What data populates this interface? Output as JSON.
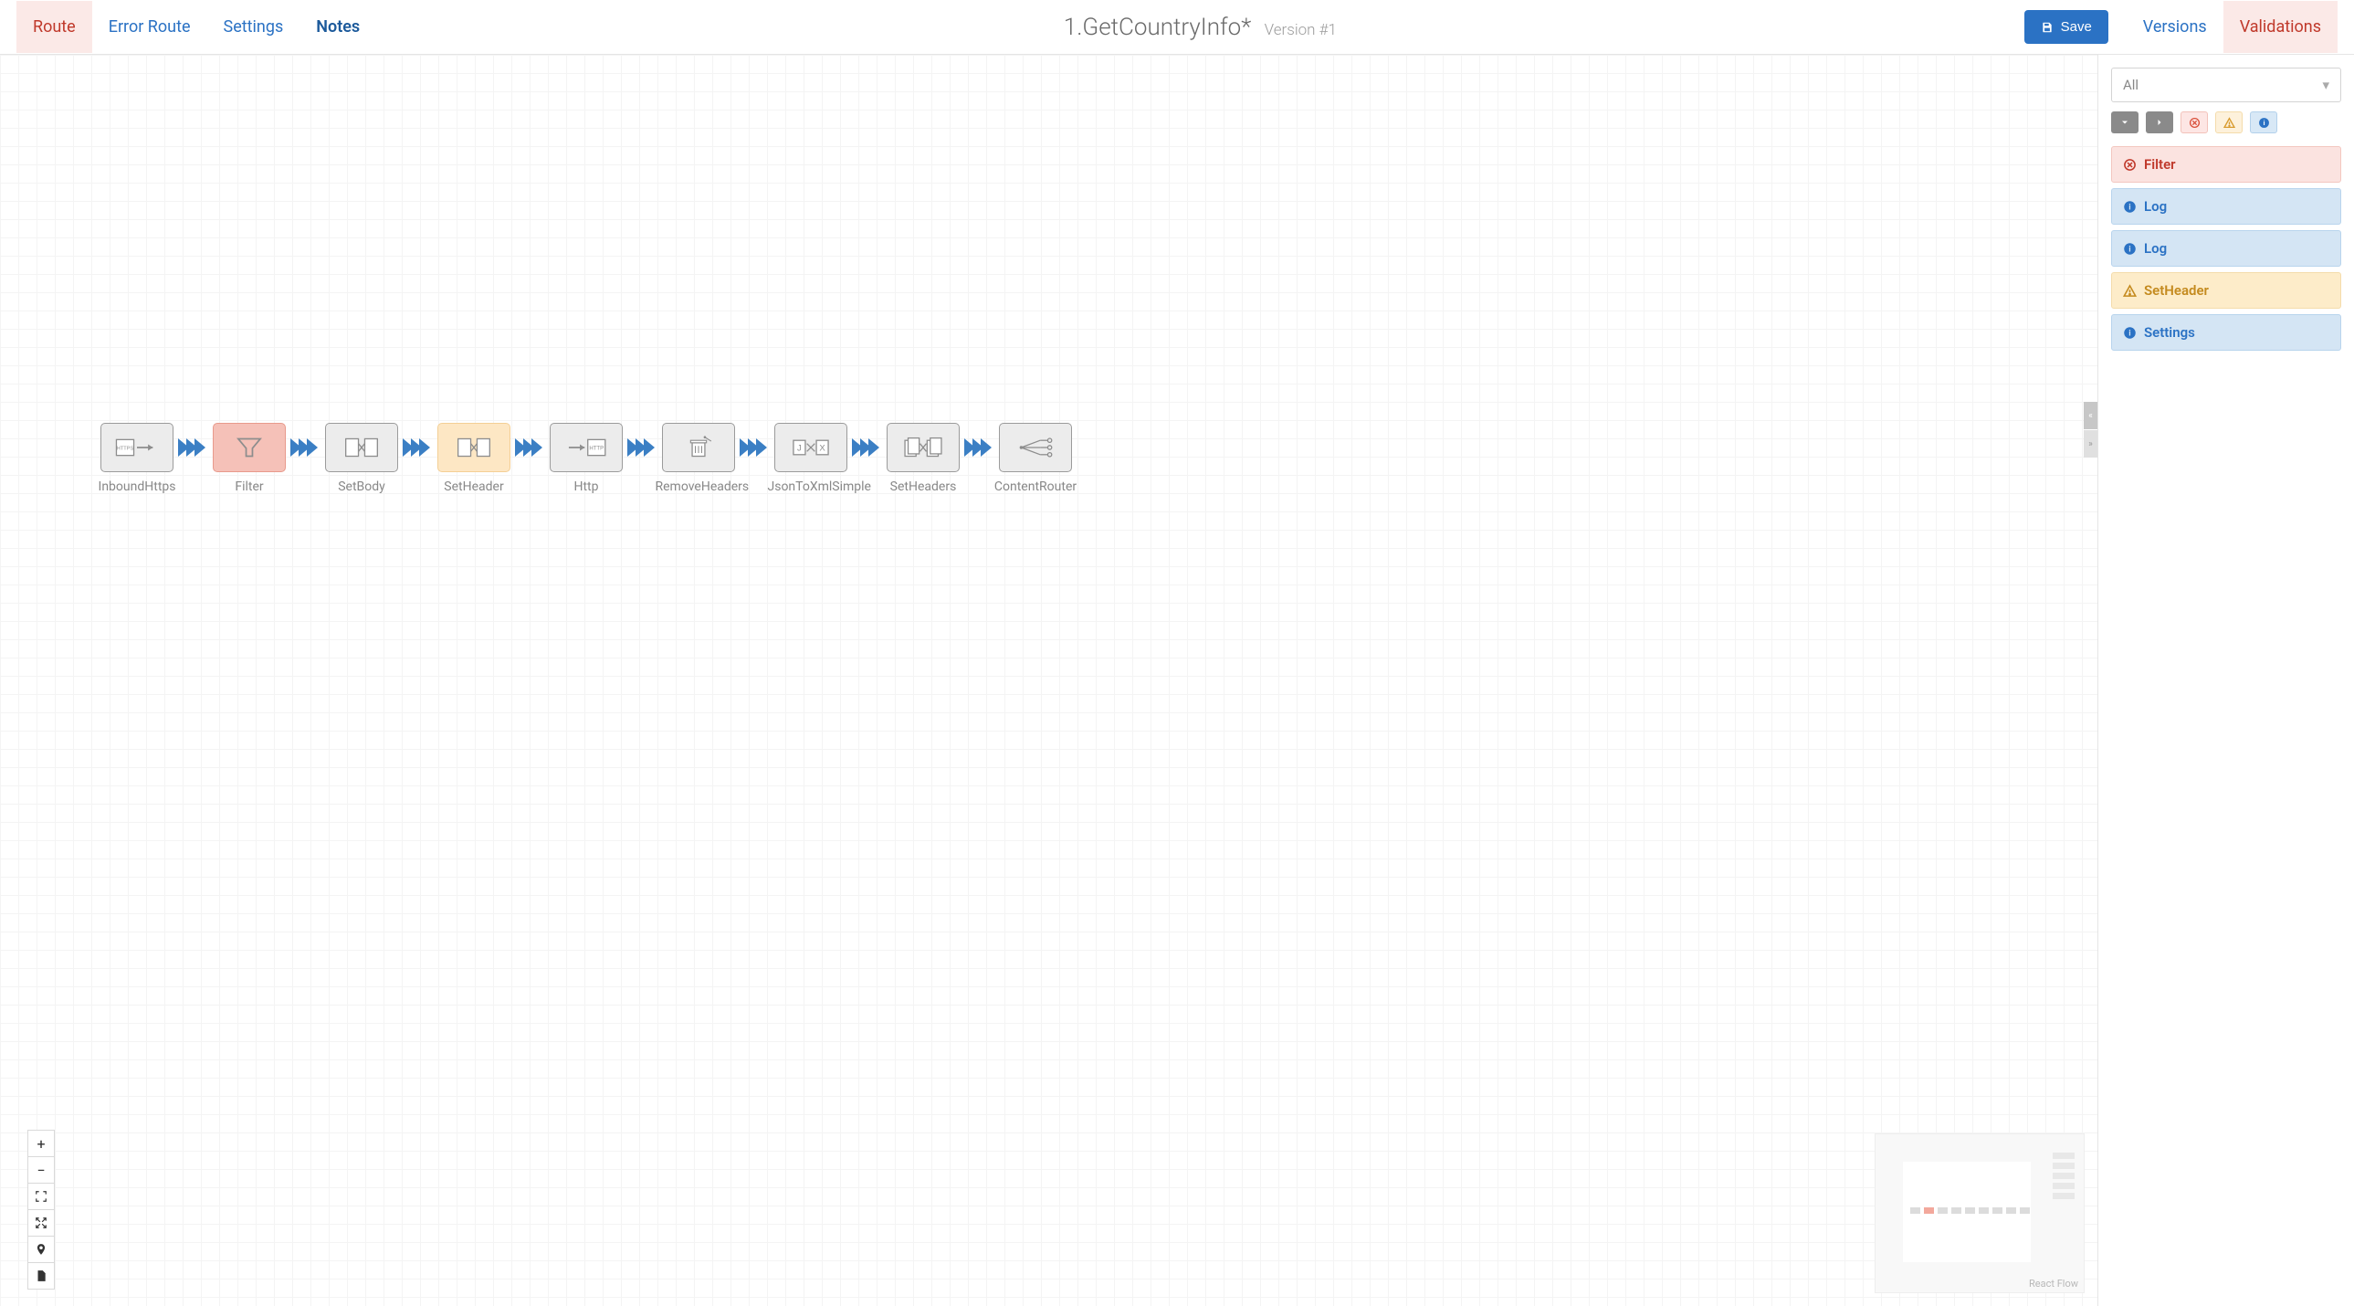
{
  "toolbar": {
    "tabs_left": [
      {
        "label": "Route",
        "state": "active"
      },
      {
        "label": "Error Route",
        "state": ""
      },
      {
        "label": "Settings",
        "state": ""
      },
      {
        "label": "Notes",
        "state": "bold"
      }
    ],
    "title": "1.GetCountryInfo*",
    "version_label": "Version #1",
    "save_label": "Save",
    "tabs_right": [
      {
        "label": "Versions",
        "state": ""
      },
      {
        "label": "Validations",
        "state": "active"
      }
    ]
  },
  "flow_nodes": [
    {
      "label": "InboundHttps",
      "state": "",
      "icon": "https-in"
    },
    {
      "label": "Filter",
      "state": "error",
      "icon": "funnel"
    },
    {
      "label": "SetBody",
      "state": "",
      "icon": "pages"
    },
    {
      "label": "SetHeader",
      "state": "warn",
      "icon": "pages"
    },
    {
      "label": "Http",
      "state": "",
      "icon": "http-out"
    },
    {
      "label": "RemoveHeaders",
      "state": "",
      "icon": "trash"
    },
    {
      "label": "JsonToXmlSimple",
      "state": "",
      "icon": "jx"
    },
    {
      "label": "SetHeaders",
      "state": "",
      "icon": "pages-multi"
    },
    {
      "label": "ContentRouter",
      "state": "",
      "icon": "router"
    }
  ],
  "panel": {
    "filter_value": "All",
    "validations": [
      {
        "type": "error",
        "label": "Filter",
        "icon": "error"
      },
      {
        "type": "info",
        "label": "Log",
        "icon": "info"
      },
      {
        "type": "info",
        "label": "Log",
        "icon": "info"
      },
      {
        "type": "warn",
        "label": "SetHeader",
        "icon": "warn"
      },
      {
        "type": "info",
        "label": "Settings",
        "icon": "info"
      }
    ]
  },
  "attribution": "React Flow"
}
